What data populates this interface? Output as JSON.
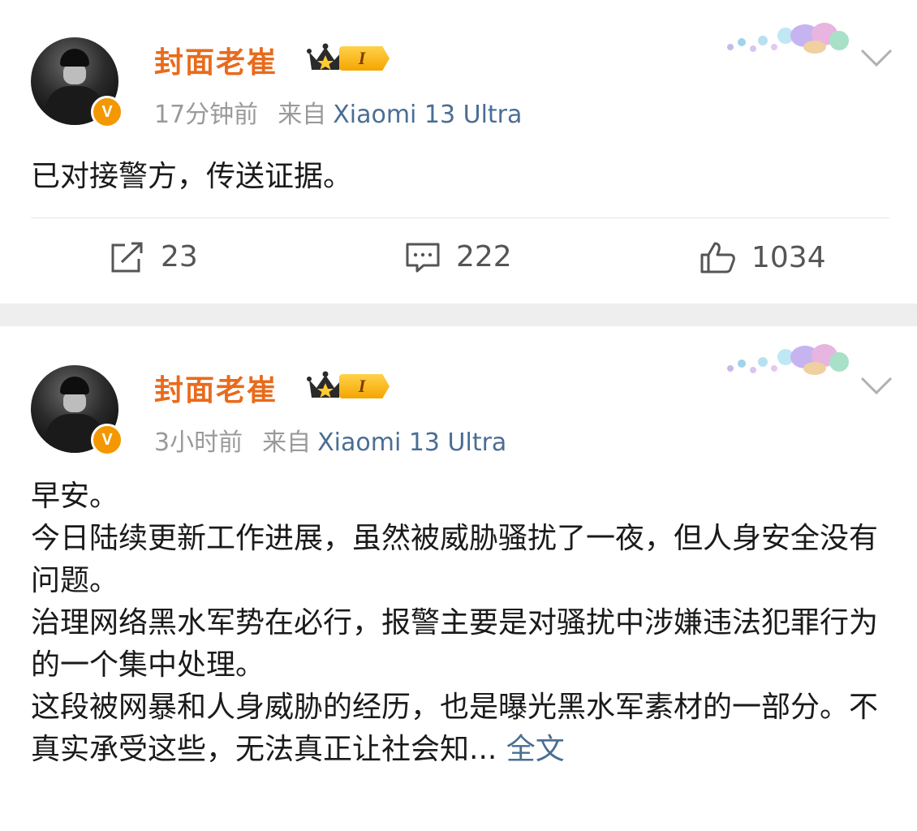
{
  "posts": [
    {
      "username": "封面老崔",
      "vip_level": "I",
      "verified_badge": "V",
      "time": "17分钟前",
      "source_label": "来自",
      "source": "Xiaomi 13 Ultra",
      "text": "已对接警方，传送证据。",
      "actions": {
        "share": "23",
        "comment": "222",
        "like": "1034"
      }
    },
    {
      "username": "封面老崔",
      "vip_level": "I",
      "verified_badge": "V",
      "time": "3小时前",
      "source_label": "来自",
      "source": "Xiaomi 13 Ultra",
      "lines": [
        "早安。",
        "今日陆续更新工作进展，虽然被威胁骚扰了一夜，但人身安全没有问题。",
        "治理网络黑水军势在必行，报警主要是对骚扰中涉嫌违法犯罪行为的一个集中处理。",
        "这段被网暴和人身威胁的经历，也是曝光黑水军素材的一部分。不真实承受这些，无法真正让社会知..."
      ],
      "full_text_link": "全文"
    }
  ],
  "colors": {
    "username": "#e86b1c",
    "link": "#4a6e94",
    "meta": "#9a9a9a",
    "badge": "#f39800",
    "separator": "#eeeeee"
  },
  "icons": [
    "share-icon",
    "comment-icon",
    "like-icon",
    "chevron-down-icon",
    "crown-icon"
  ]
}
